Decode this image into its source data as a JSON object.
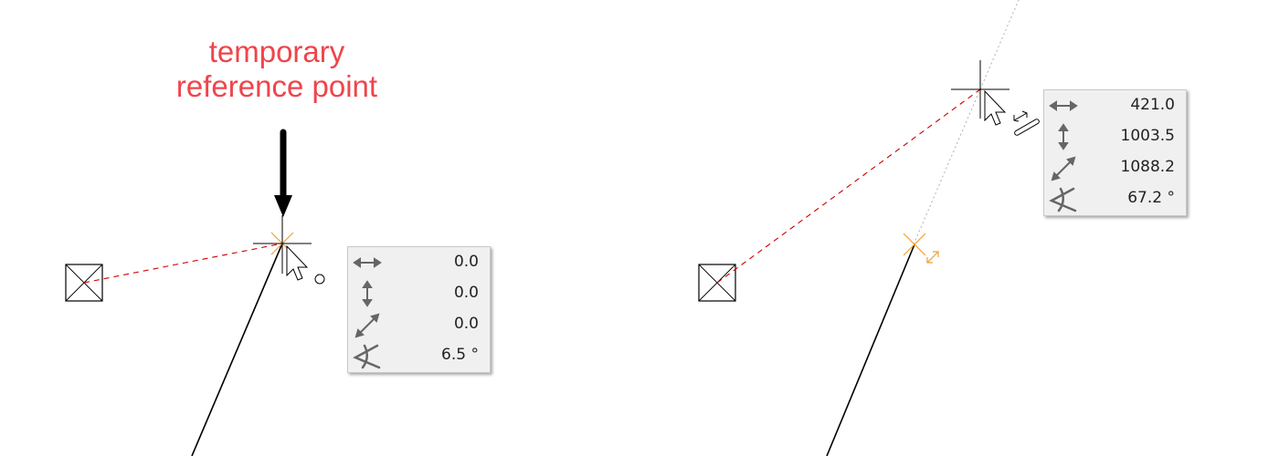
{
  "annotation": {
    "line1": "temporary",
    "line2": "reference point",
    "color": "#f0444c"
  },
  "colors": {
    "snap_marker": "#f0a030",
    "rubber_band": "#cc0000",
    "guide_line": "#b0b0b0",
    "geometry": "#000000"
  },
  "left_panel": {
    "tooltip": {
      "rows": [
        {
          "icon": "horizontal-distance-icon",
          "value": "0.0"
        },
        {
          "icon": "vertical-distance-icon",
          "value": "0.0"
        },
        {
          "icon": "diagonal-distance-icon",
          "value": "0.0"
        },
        {
          "icon": "angle-icon",
          "value": "6.5 °"
        }
      ]
    }
  },
  "right_panel": {
    "tooltip": {
      "rows": [
        {
          "icon": "horizontal-distance-icon",
          "value": "421.0"
        },
        {
          "icon": "vertical-distance-icon",
          "value": "1003.5"
        },
        {
          "icon": "diagonal-distance-icon",
          "value": "1088.2"
        },
        {
          "icon": "angle-icon",
          "value": "67.2 °"
        }
      ]
    }
  }
}
